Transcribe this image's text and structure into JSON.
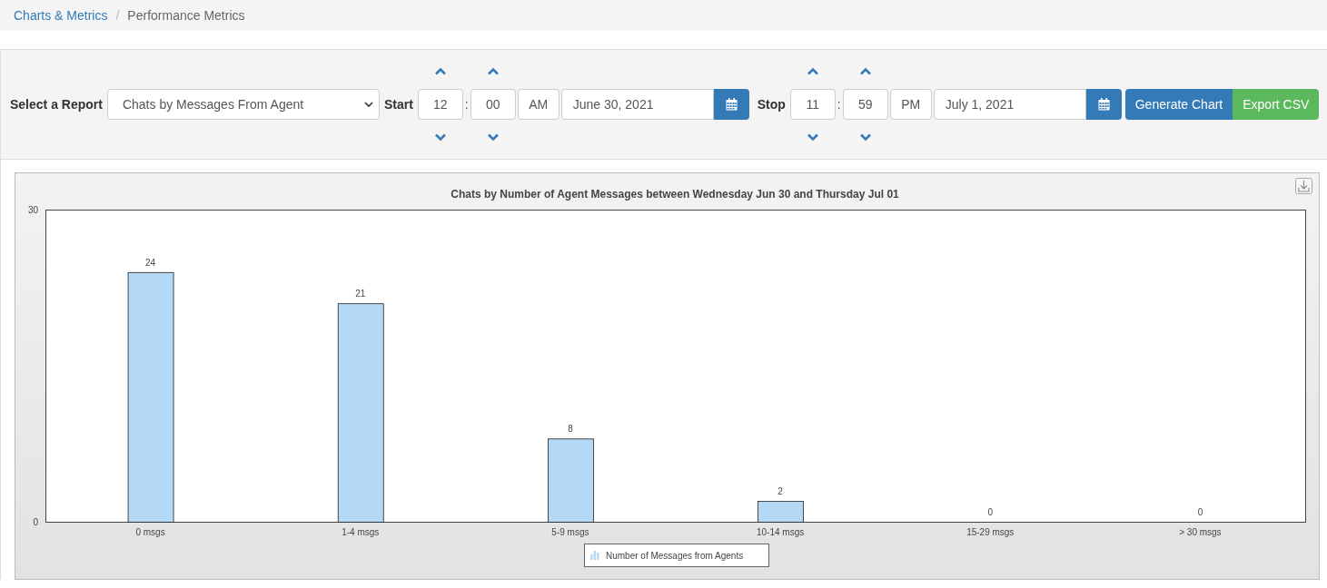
{
  "breadcrumb": [
    {
      "label": "Charts & Metrics",
      "link": true
    },
    {
      "label": "Performance Metrics",
      "link": false
    }
  ],
  "breadcrumb_separator": "/",
  "toolbar": {
    "report_label": "Select a Report",
    "report_value": "Chats by Messages From Agent",
    "ranges": [
      {
        "label": "Start",
        "hour": "12",
        "separator": ":",
        "minute": "00",
        "ampm": "AM",
        "date": "June 30, 2021"
      },
      {
        "label": "Stop",
        "hour": "11",
        "separator": ":",
        "minute": "59",
        "ampm": "PM",
        "date": "July 1, 2021"
      }
    ],
    "buttons": [
      {
        "label": "Generate Chart",
        "kind": "primary"
      },
      {
        "label": "Export CSV",
        "kind": "success"
      }
    ]
  },
  "chart": {
    "chart_data": {
      "type": "bar",
      "title": "Chats by Number of Agent Messages between Wednesday Jun 30 and Thursday Jul 01",
      "categories": [
        "0 msgs",
        "1-4 msgs",
        "5-9 msgs",
        "10-14 msgs",
        "15-29 msgs",
        "> 30 msgs"
      ],
      "series": [
        {
          "name": "Number of Messages from Agents",
          "color": "#b3d9f7",
          "values": [
            24,
            21,
            8,
            2,
            0,
            0
          ]
        }
      ],
      "ylim": [
        0,
        30
      ],
      "yticks": [
        0,
        30
      ],
      "data_labels": true
    }
  }
}
